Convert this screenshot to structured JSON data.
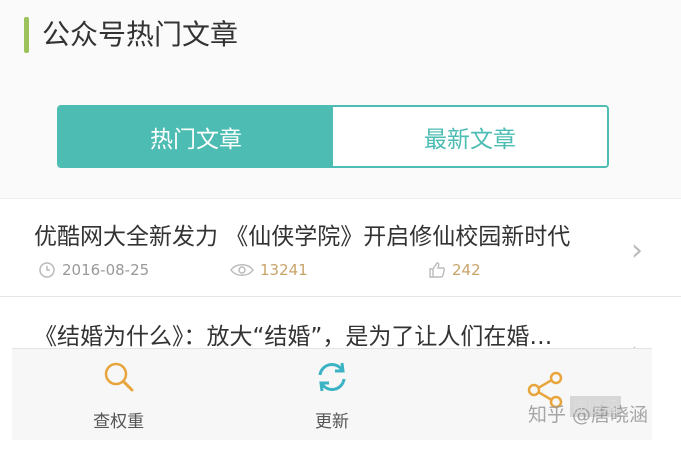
{
  "header": {
    "title": "公众号热门文章"
  },
  "tabs": [
    {
      "label": "热门文章",
      "active": true
    },
    {
      "label": "最新文章",
      "active": false
    }
  ],
  "articles": [
    {
      "title": "优酷网大全新发力 《仙侠学院》开启修仙校园新时代",
      "date": "2016-08-25",
      "views": "13241",
      "likes": "242"
    },
    {
      "title": "《结婚为什么》：放大“结婚”，是为了让人们在婚…"
    }
  ],
  "bottom_nav": [
    {
      "label": "查权重",
      "icon": "search-icon"
    },
    {
      "label": "更新",
      "icon": "refresh-icon"
    },
    {
      "label": "",
      "icon": "share-icon"
    }
  ],
  "watermark": {
    "text": "知乎 @唐晓涵",
    "overlay": "唐晓涵"
  },
  "colors": {
    "accent": "#4dbdb3",
    "header_bar": "#9cc35b",
    "meta_highlight": "#c9a46a",
    "nav_icon": "#e8a53c"
  }
}
